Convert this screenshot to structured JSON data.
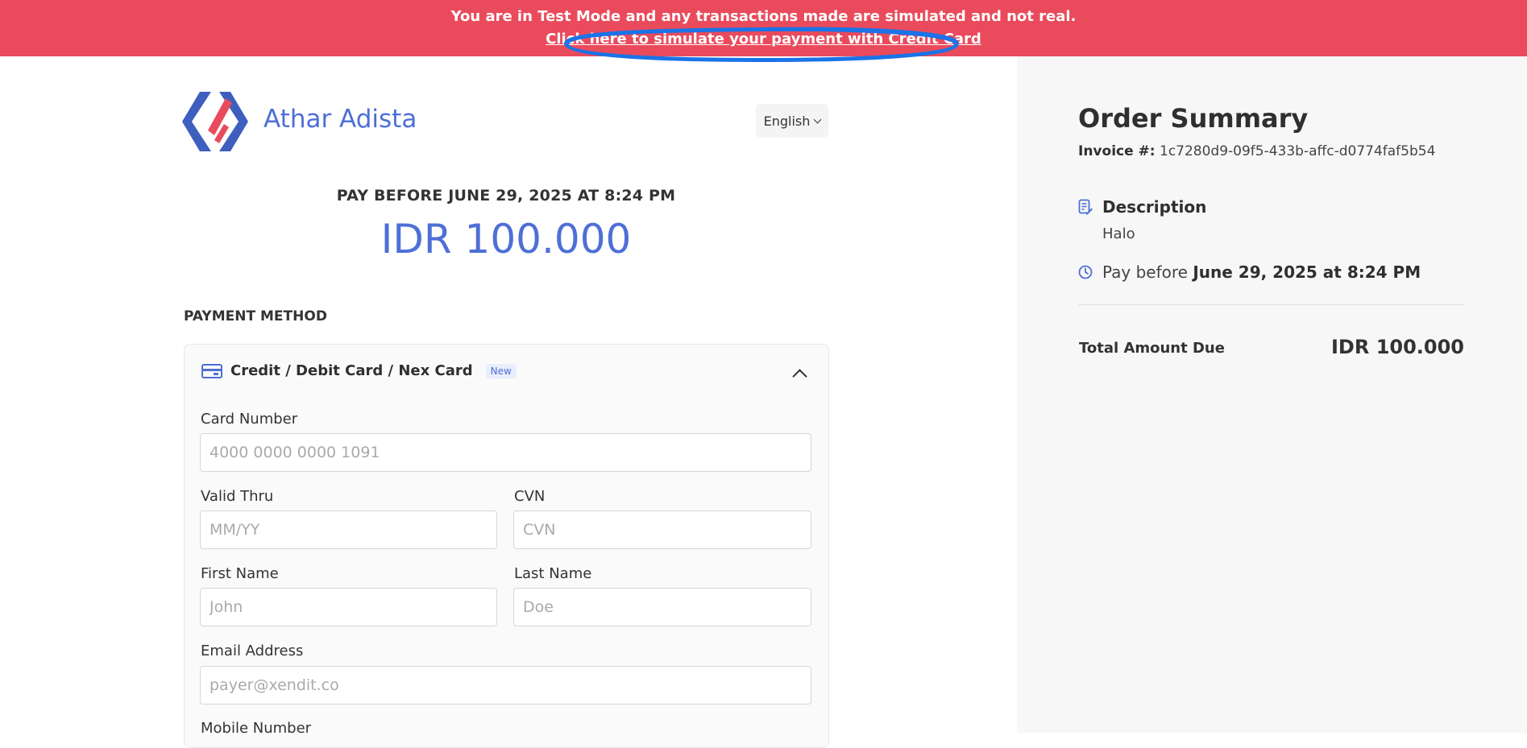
{
  "banner": {
    "notice": "You are in Test Mode and any transactions made are simulated and not real.",
    "simulate_link": "Click here to simulate your payment with Credit Card"
  },
  "brand": {
    "name": "Athar Adista",
    "logo_icon": "hexagon-logo-icon"
  },
  "language": {
    "selected": "English"
  },
  "payment": {
    "pay_before": "PAY BEFORE JUNE 29, 2025 AT 8:24 PM",
    "amount": "IDR 100.000",
    "method_label": "PAYMENT METHOD"
  },
  "card_form": {
    "title": "Credit / Debit Card / Nex Card",
    "badge": "New",
    "card_number": {
      "label": "Card Number",
      "placeholder": "4000 0000 0000 1091"
    },
    "valid_thru": {
      "label": "Valid Thru",
      "placeholder": "MM/YY"
    },
    "cvn": {
      "label": "CVN",
      "placeholder": "CVN"
    },
    "first_name": {
      "label": "First Name",
      "placeholder": "John"
    },
    "last_name": {
      "label": "Last Name",
      "placeholder": "Doe"
    },
    "email": {
      "label": "Email Address",
      "placeholder": "payer@xendit.co"
    },
    "mobile": {
      "label": "Mobile Number"
    }
  },
  "summary": {
    "title": "Order Summary",
    "invoice_label": "Invoice #:",
    "invoice_id": "1c7280d9-09f5-433b-affc-d0774faf5b54",
    "description_label": "Description",
    "description_value": "Halo",
    "pay_before_prefix": "Pay before",
    "pay_before_date": "June 29, 2025 at 8:24 PM",
    "total_label": "Total Amount Due",
    "total_value": "IDR 100.000"
  },
  "colors": {
    "banner": "#e94b5c",
    "accent": "#4e6fd6",
    "annotation": "#1a73e8"
  }
}
